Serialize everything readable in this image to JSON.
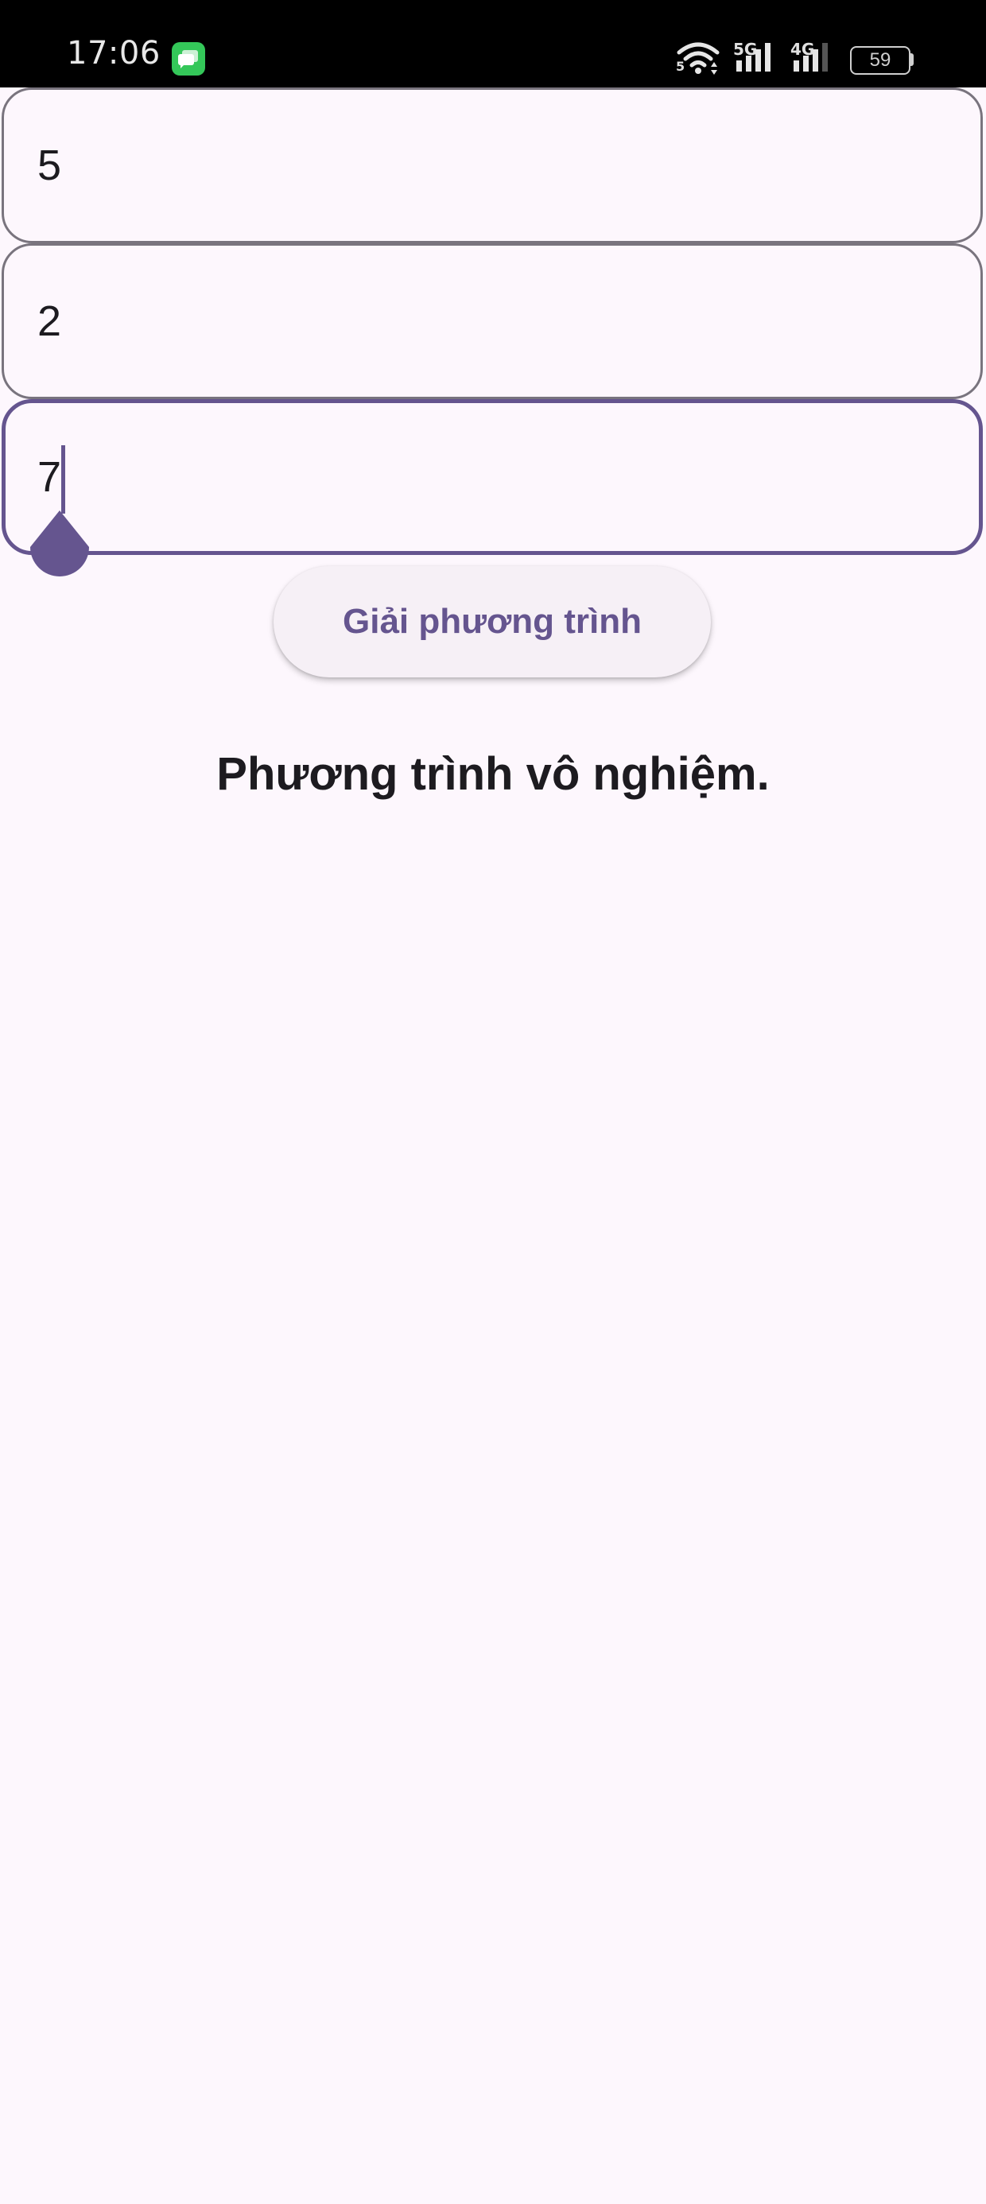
{
  "status_bar": {
    "time": "17:06",
    "network_5g_label": "5G",
    "network_4g_label": "4G",
    "wifi_sub_label": "5",
    "battery_level": "59",
    "icons": [
      "messages-app-icon",
      "wifi-icon",
      "signal-icon",
      "battery-icon"
    ]
  },
  "form": {
    "field_1_value": "5",
    "field_2_value": "2",
    "field_3_value": "7"
  },
  "solve_button_label": "Giải phương trình",
  "result_text": "Phương trình vô nghiệm.",
  "colors": {
    "accent": "#65558f",
    "background": "#fdf7fd",
    "outline": "#79747e",
    "text": "#1d1b20"
  }
}
